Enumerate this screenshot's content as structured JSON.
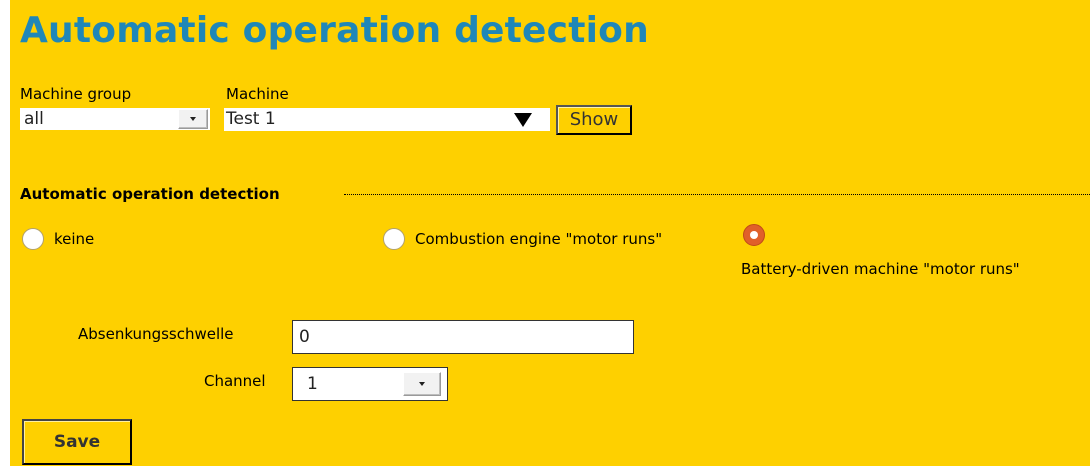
{
  "page": {
    "title": "Automatic operation detection"
  },
  "filters": {
    "machine_group_label": "Machine group",
    "machine_group_value": "all",
    "machine_label": "Machine",
    "machine_value": "Test 1",
    "show_label": "Show"
  },
  "detection": {
    "legend": "Automatic operation detection",
    "options": [
      {
        "label": "keine",
        "checked": false
      },
      {
        "label": "Combustion engine \"motor runs\"",
        "checked": false
      },
      {
        "label": "Battery-driven machine \"motor runs\"",
        "checked": true
      }
    ],
    "threshold_label": "Absenkungsschwelle",
    "threshold_value": "0",
    "channel_label": "Channel",
    "channel_value": "1"
  },
  "actions": {
    "save_label": "Save"
  },
  "colors": {
    "background": "#fed000",
    "title": "#1f87b8",
    "radio_selected": "#e0602a"
  },
  "icons": {
    "select_dropdown": "small-down-triangle",
    "machine_dropdown": "large-down-triangle"
  }
}
